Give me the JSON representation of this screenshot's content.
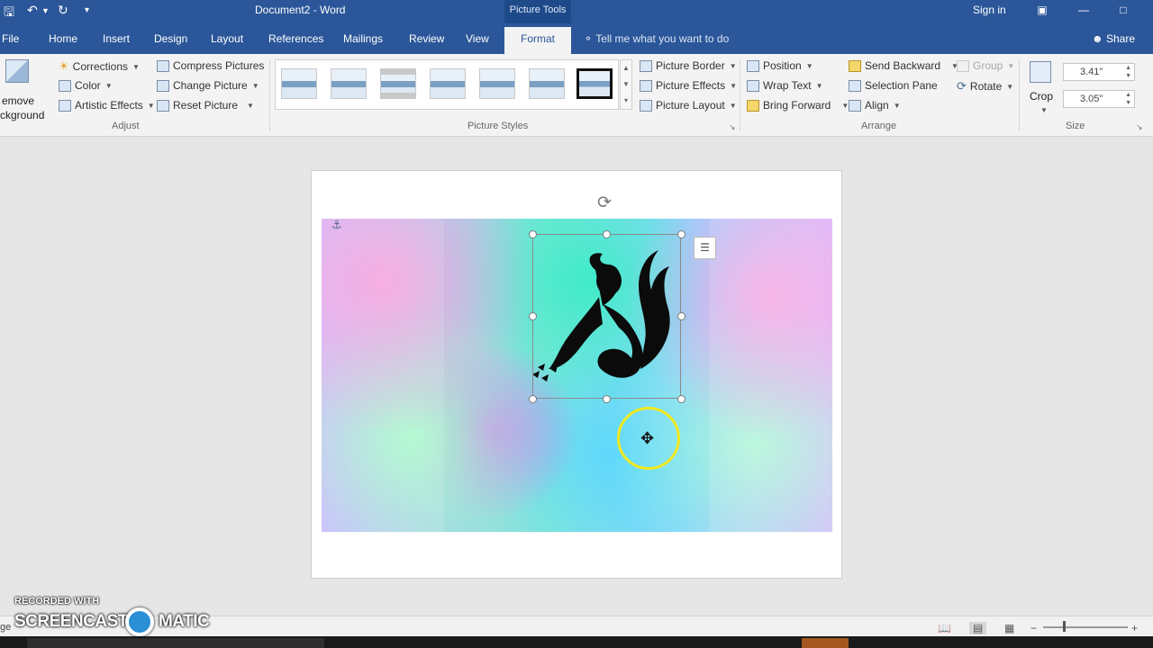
{
  "window": {
    "title": "Document2 - Word",
    "context_tab_group": "Picture Tools",
    "sign_in": "Sign in"
  },
  "tabs": [
    {
      "label": "File"
    },
    {
      "label": "Home"
    },
    {
      "label": "Insert"
    },
    {
      "label": "Design"
    },
    {
      "label": "Layout"
    },
    {
      "label": "References"
    },
    {
      "label": "Mailings"
    },
    {
      "label": "Review"
    },
    {
      "label": "View"
    },
    {
      "label": "Format",
      "active": true
    }
  ],
  "tell_me": "Tell me what you want to do",
  "share": "Share",
  "ribbon": {
    "adjust": {
      "remove_background_line1": "emove",
      "remove_background_line2": "ckground",
      "corrections": "Corrections",
      "color": "Color",
      "artistic_effects": "Artistic Effects",
      "compress_pictures": "Compress Pictures",
      "change_picture": "Change Picture",
      "reset_picture": "Reset Picture",
      "label": "Adjust"
    },
    "picture_styles": {
      "picture_border": "Picture Border",
      "picture_effects": "Picture Effects",
      "picture_layout": "Picture Layout",
      "label": "Picture Styles"
    },
    "arrange": {
      "position": "Position",
      "wrap_text": "Wrap Text",
      "bring_forward": "Bring Forward",
      "send_backward": "Send Backward",
      "selection_pane": "Selection Pane",
      "align": "Align",
      "group": "Group",
      "rotate": "Rotate",
      "label": "Arrange"
    },
    "size": {
      "crop": "Crop",
      "height": "3.41\"",
      "width": "3.05\"",
      "label": "Size"
    }
  },
  "status": {
    "left_text": "ge"
  },
  "watermark": {
    "line1": "RECORDED WITH",
    "line2a": "SCREENCAST",
    "line2b": "MATIC"
  },
  "colors": {
    "brand": "#2b579a",
    "ribbon": "#f3f3f3",
    "highlight_ring": "#f1e91f"
  }
}
